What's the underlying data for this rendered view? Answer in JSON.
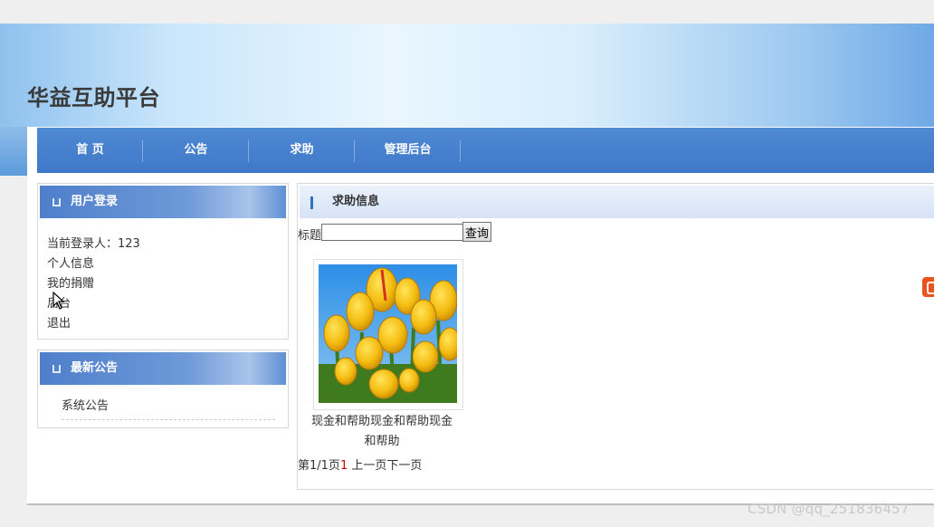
{
  "site": {
    "title": "华益互助平台"
  },
  "nav": {
    "items": [
      "首 页",
      "公告",
      "求助",
      "管理后台"
    ]
  },
  "login_box": {
    "title": "用户登录",
    "current_user_label": "当前登录人：123",
    "links": [
      "个人信息",
      "我的捐赠",
      "后台",
      "退出"
    ]
  },
  "notice_box": {
    "title": "最新公告",
    "items": [
      "系统公告"
    ]
  },
  "help_panel": {
    "title": "求助信息",
    "search": {
      "label": "标题",
      "value": "",
      "button": "查询"
    },
    "cards": [
      {
        "caption": "现金和帮助现金和帮助现金和帮助",
        "image_icon": "tulips-image"
      }
    ],
    "pager": {
      "prefix": "第1/1页",
      "current": "1",
      "prev": "上一页",
      "next": "下一页"
    }
  },
  "watermark": "CSDN @qq_251836457",
  "colors": {
    "nav_bg": "#4682cf",
    "box_head": "#5a88d0",
    "pager_current": "#cc0000"
  }
}
